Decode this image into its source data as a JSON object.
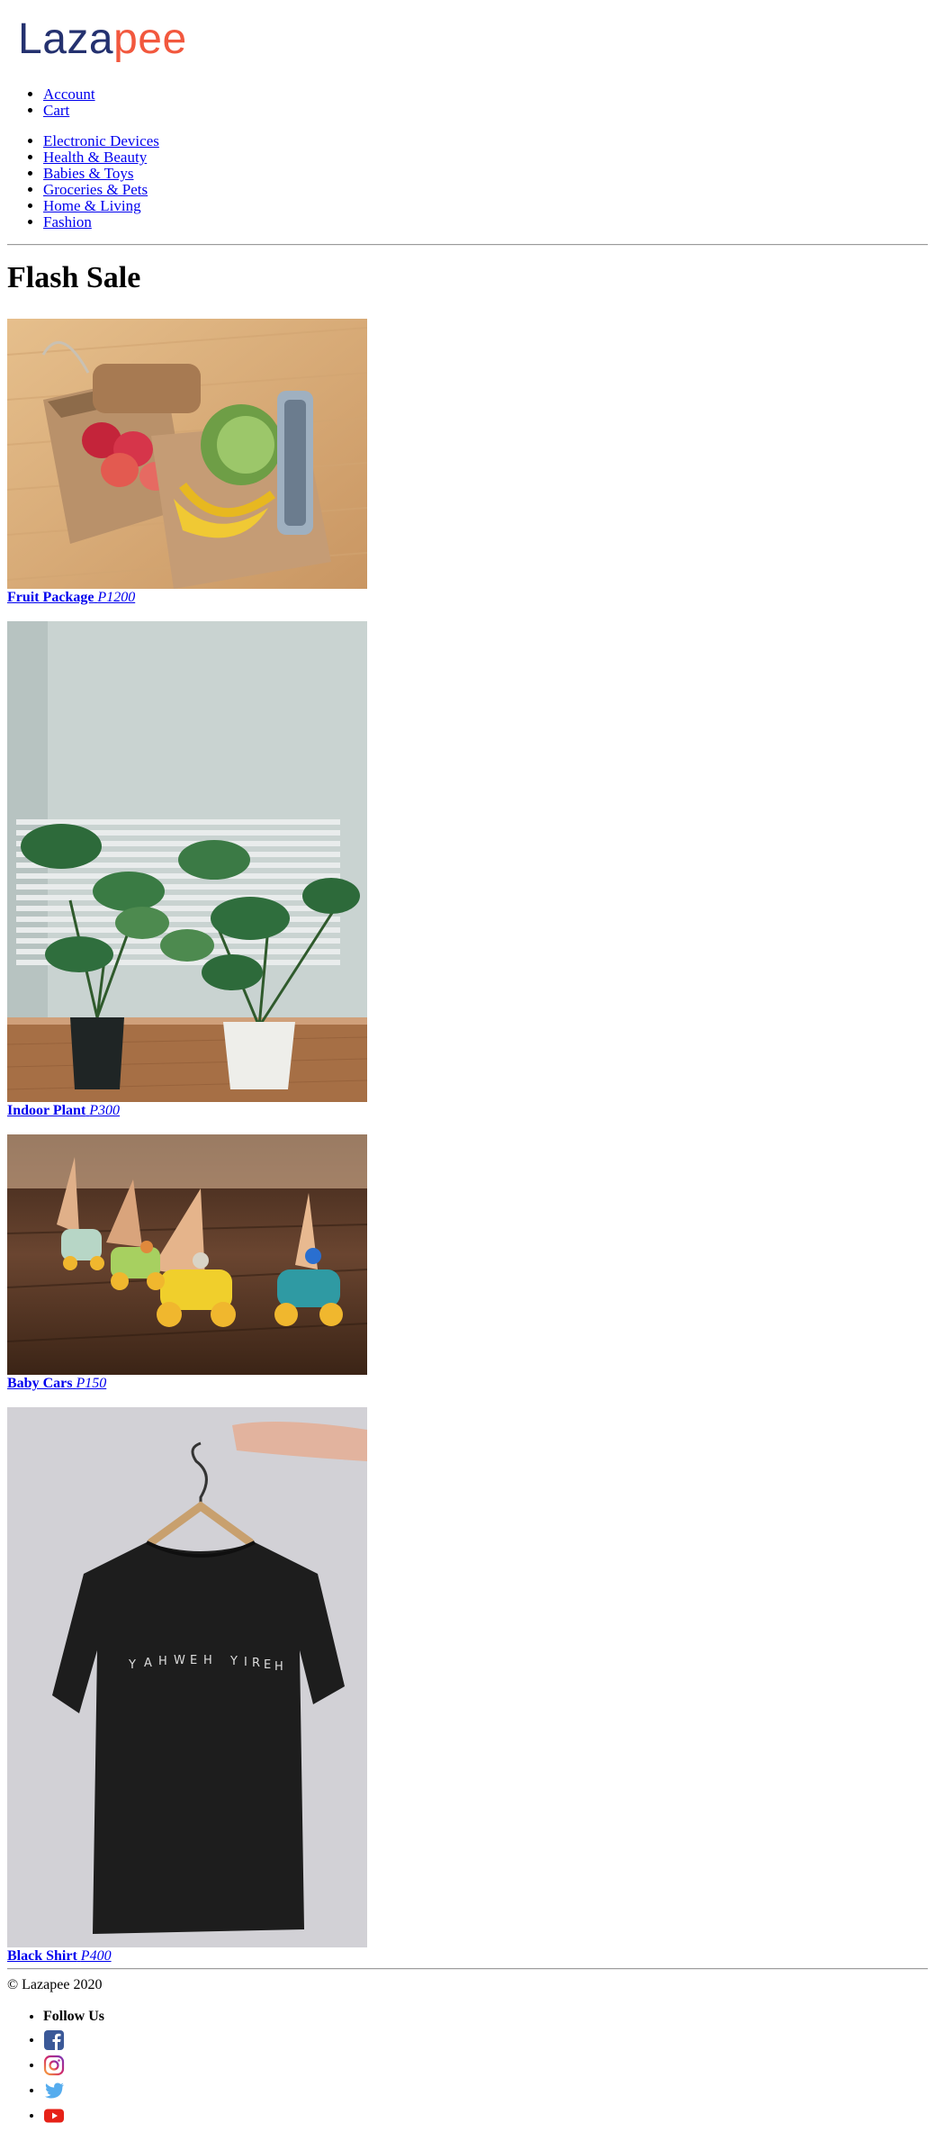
{
  "brand": {
    "part1": "Laza",
    "part2": "pee"
  },
  "account_nav": [
    {
      "label": "Account"
    },
    {
      "label": "Cart"
    }
  ],
  "categories": [
    {
      "label": "Electronic Devices"
    },
    {
      "label": "Health & Beauty"
    },
    {
      "label": "Babies & Toys"
    },
    {
      "label": "Groceries & Pets"
    },
    {
      "label": "Home & Living"
    },
    {
      "label": "Fashion"
    }
  ],
  "flash_sale": {
    "heading": "Flash Sale",
    "products": [
      {
        "name": "Fruit Package",
        "price": "P1200"
      },
      {
        "name": "Indoor Plant",
        "price": "P300"
      },
      {
        "name": "Baby Cars",
        "price": "P150"
      },
      {
        "name": "Black Shirt",
        "price": "P400"
      }
    ]
  },
  "footer": {
    "copyright": "© Lazapee 2020",
    "follow_label": "Follow Us",
    "social_icons": [
      "facebook-icon",
      "instagram-icon",
      "twitter-icon",
      "youtube-icon"
    ],
    "colors": {
      "facebook": "#3b5998",
      "instagram": "#c13584",
      "twitter": "#55acee",
      "youtube": "#e62117"
    }
  }
}
